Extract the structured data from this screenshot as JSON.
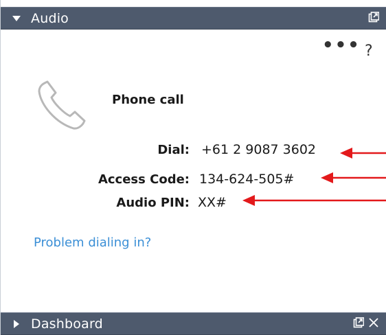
{
  "audio_panel": {
    "title": "Audio",
    "more_label": "•••",
    "help_label": "?",
    "phone_call_label": "Phone call",
    "dial_label": "Dial:",
    "dial_value": "+61 2 9087 3602",
    "access_code_label": "Access Code:",
    "access_code_value": "134-624-505#",
    "audio_pin_label": "Audio PIN:",
    "audio_pin_value": "XX#",
    "problem_link": "Problem dialing in?"
  },
  "dashboard_panel": {
    "title": "Dashboard"
  },
  "colors": {
    "titlebar": "#4e5a6d",
    "link": "#3b8fd6",
    "annotation_arrow": "#e3191b"
  },
  "icons": [
    "collapse-triangle-icon",
    "popout-icon",
    "more-icon",
    "help-icon",
    "phone-icon",
    "expand-triangle-icon",
    "close-icon"
  ]
}
